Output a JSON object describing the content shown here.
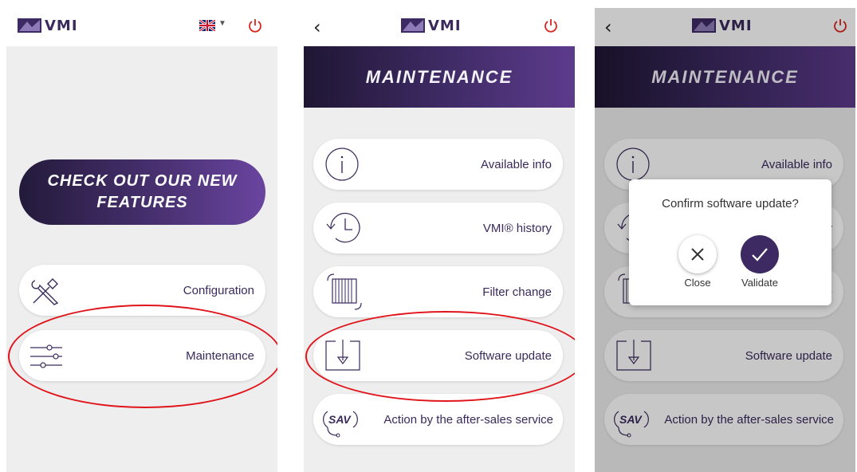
{
  "brand": {
    "name": "VMI",
    "accent": "#3d2a63",
    "power_color": "#d9261c",
    "highlight": "#e0141b"
  },
  "screen1": {
    "language_icon": "uk-flag-icon",
    "promo_label": "CHECK OUT OUR NEW FEATURES",
    "menu": [
      {
        "label": "Configuration",
        "icon": "tools-icon"
      },
      {
        "label": "Maintenance",
        "icon": "sliders-icon"
      }
    ]
  },
  "screen2": {
    "title": "MAINTENANCE",
    "items": [
      {
        "label": "Available info",
        "icon": "info-icon"
      },
      {
        "label": "VMI® history",
        "icon": "history-icon"
      },
      {
        "label": "Filter change",
        "icon": "filter-icon"
      },
      {
        "label": "Software update",
        "icon": "download-icon"
      },
      {
        "label": "Action by the after-sales service",
        "icon": "sav-icon",
        "icon_text": "SAV"
      }
    ]
  },
  "screen3": {
    "title": "MAINTENANCE",
    "items": [
      {
        "label": "Available info"
      },
      {
        "label": "ry"
      },
      {
        "label": "ge"
      },
      {
        "label": "Software update"
      },
      {
        "label": "Action by the after-sales service",
        "icon_text": "SAV"
      }
    ],
    "dialog": {
      "question": "Confirm software update?",
      "close_label": "Close",
      "validate_label": "Validate"
    }
  }
}
